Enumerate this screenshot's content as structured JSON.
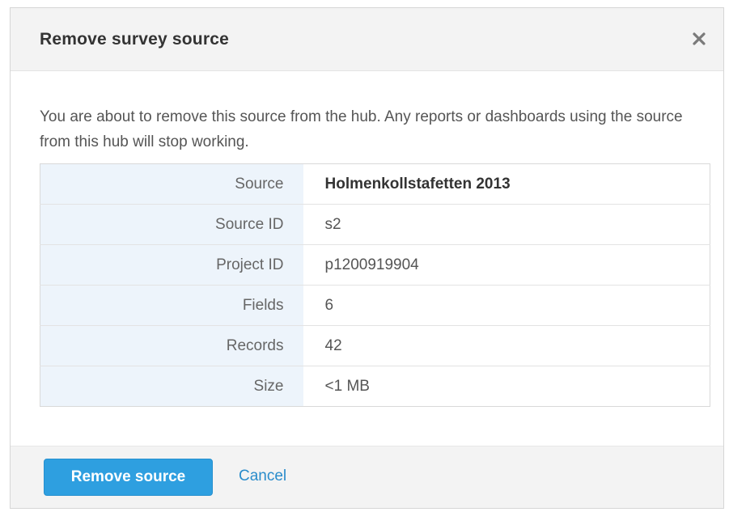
{
  "dialog": {
    "title": "Remove survey source",
    "close_icon": "close-icon",
    "message": "You are about to remove this source from the hub. Any reports or dashboards using the source from this hub will stop working.",
    "details": [
      {
        "label": "Source",
        "value": "Holmenkollstafetten 2013"
      },
      {
        "label": "Source ID",
        "value": "s2"
      },
      {
        "label": "Project ID",
        "value": "p1200919904"
      },
      {
        "label": "Fields",
        "value": "6"
      },
      {
        "label": "Records",
        "value": "42"
      },
      {
        "label": "Size",
        "value": "<1 MB"
      }
    ],
    "primary_button_label": "Remove source",
    "cancel_label": "Cancel"
  },
  "colors": {
    "primary": "#2e9fe0",
    "link": "#2a8ccb",
    "label_cell_bg": "#edf4fb",
    "header_bg": "#f3f3f3"
  }
}
